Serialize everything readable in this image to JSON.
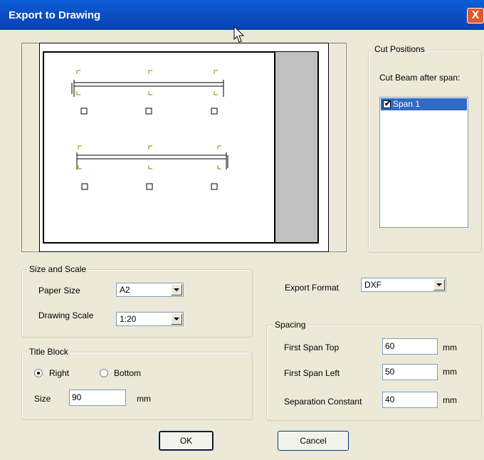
{
  "window": {
    "title": "Export to Drawing",
    "close_glyph": "X"
  },
  "preview": {
    "beams": [
      {
        "supports": 3,
        "boxes": 3
      },
      {
        "supports": 3,
        "boxes": 3
      }
    ]
  },
  "cut_positions": {
    "legend": "Cut Positions",
    "label": "Cut Beam after span:",
    "items": [
      {
        "label": "Span 1",
        "checked": true
      }
    ]
  },
  "size_scale": {
    "legend": "Size and Scale",
    "paper_size_label": "Paper Size",
    "paper_size_value": "A2",
    "drawing_scale_label": "Drawing Scale",
    "drawing_scale_value": "1:20"
  },
  "export": {
    "format_label": "Export Format",
    "format_value": "DXF"
  },
  "title_block": {
    "legend": "Title Block",
    "right_label": "Right",
    "bottom_label": "Bottom",
    "selected": "Right",
    "size_label": "Size",
    "size_value": "90",
    "unit": "mm"
  },
  "spacing": {
    "legend": "Spacing",
    "rows": [
      {
        "label": "First Span Top",
        "value": "60",
        "unit": "mm"
      },
      {
        "label": "First Span Left",
        "value": "50",
        "unit": "mm"
      },
      {
        "label": "Separation Constant",
        "value": "40",
        "unit": "mm"
      }
    ]
  },
  "buttons": {
    "ok": "OK",
    "cancel": "Cancel"
  }
}
